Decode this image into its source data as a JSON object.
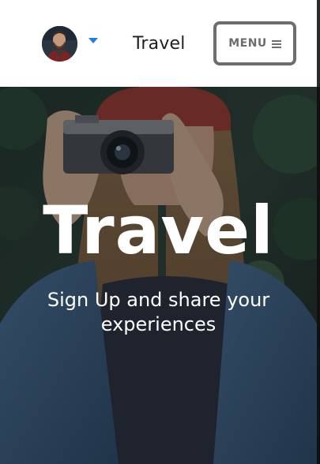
{
  "navbar": {
    "avatar_icon": "user-avatar",
    "dropdown_icon": "caret-down-icon",
    "title": "Travel",
    "menu_label": "MENU",
    "menu_icon": "hamburger-icon",
    "accent_color": "#1a7fe0"
  },
  "hero": {
    "title": "Travel",
    "subtitle": "Sign Up and share your experiences",
    "background": "photo-woman-with-camera"
  }
}
